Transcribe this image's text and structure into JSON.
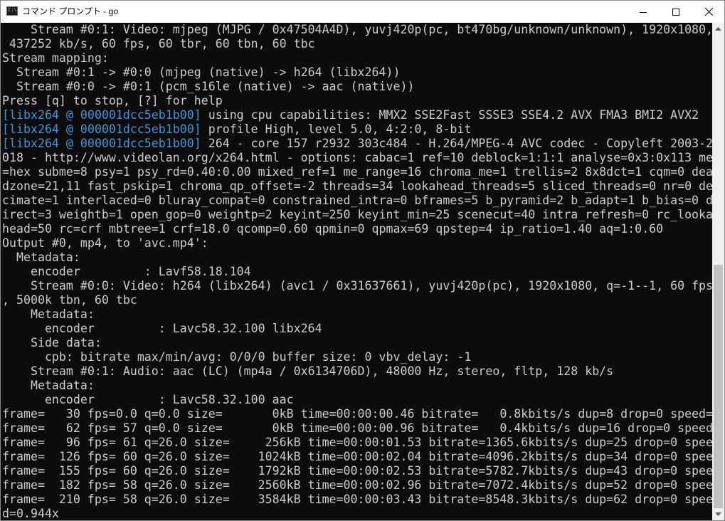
{
  "window": {
    "title": "コマンド プロンプト - go",
    "icon": "cmd-icon",
    "icon_text": "C:\\.",
    "controls": [
      "minimize-icon",
      "maximize-icon",
      "close-icon"
    ]
  },
  "colors": {
    "console_bg": "#0c0c0c",
    "console_text": "#cccccc",
    "tag_text": "#3a96dd"
  },
  "console": {
    "lines": [
      {
        "text": "    Stream #0:1: Video: mjpeg (MJPG / 0x47504A4D), yuvj420p(pc, bt470bg/unknown/unknown), 1920x1080,"
      },
      {
        "text": " 437252 kb/s, 60 fps, 60 tbr, 60 tbn, 60 tbc"
      },
      {
        "text": "Stream mapping:"
      },
      {
        "text": "  Stream #0:1 -> #0:0 (mjpeg (native) -> h264 (libx264))"
      },
      {
        "text": "  Stream #0:0 -> #0:1 (pcm_s16le (native) -> aac (native))"
      },
      {
        "text": "Press [q] to stop, [?] for help"
      },
      {
        "tag": "[libx264 @ 000001dcc5eb1b00]",
        "text": " using cpu capabilities: MMX2 SSE2Fast SSSE3 SSE4.2 AVX FMA3 BMI2 AVX2"
      },
      {
        "tag": "[libx264 @ 000001dcc5eb1b00]",
        "text": " profile High, level 5.0, 4:2:0, 8-bit"
      },
      {
        "tag": "[libx264 @ 000001dcc5eb1b00]",
        "text": " 264 - core 157 r2932 303c484 - H.264/MPEG-4 AVC codec - Copyleft 2003-2"
      },
      {
        "text": "018 - http://www.videolan.org/x264.html - options: cabac=1 ref=10 deblock=1:1:1 analyse=0x3:0x113 me"
      },
      {
        "text": "=hex subme=8 psy=1 psy_rd=0.40:0.00 mixed_ref=1 me_range=16 chroma_me=1 trellis=2 8x8dct=1 cqm=0 dea"
      },
      {
        "text": "dzone=21,11 fast_pskip=1 chroma_qp_offset=-2 threads=34 lookahead_threads=5 sliced_threads=0 nr=0 de"
      },
      {
        "text": "cimate=1 interlaced=0 bluray_compat=0 constrained_intra=0 bframes=5 b_pyramid=2 b_adapt=1 b_bias=0 d"
      },
      {
        "text": "irect=3 weightb=1 open_gop=0 weightp=2 keyint=250 keyint_min=25 scenecut=40 intra_refresh=0 rc_looka"
      },
      {
        "text": "head=50 rc=crf mbtree=1 crf=18.0 qcomp=0.60 qpmin=0 qpmax=69 qpstep=4 ip_ratio=1.40 aq=1:0.60"
      },
      {
        "text": "Output #0, mp4, to 'avc.mp4':"
      },
      {
        "text": "  Metadata:"
      },
      {
        "text": "    encoder         : Lavf58.18.104"
      },
      {
        "text": "    Stream #0:0: Video: h264 (libx264) (avc1 / 0x31637661), yuvj420p(pc), 1920x1080, q=-1--1, 60 fps"
      },
      {
        "text": ", 5000k tbn, 60 tbc"
      },
      {
        "text": "    Metadata:"
      },
      {
        "text": "      encoder         : Lavc58.32.100 libx264"
      },
      {
        "text": "    Side data:"
      },
      {
        "text": "      cpb: bitrate max/min/avg: 0/0/0 buffer size: 0 vbv_delay: -1"
      },
      {
        "text": "    Stream #0:1: Audio: aac (LC) (mp4a / 0x6134706D), 48000 Hz, stereo, fltp, 128 kb/s"
      },
      {
        "text": "    Metadata:"
      },
      {
        "text": "      encoder         : Lavc58.32.100 aac"
      },
      {
        "text": "frame=   30 fps=0.0 q=0.0 size=       0kB time=00:00:00.46 bitrate=   0.8kbits/s dup=8 drop=0 speed="
      },
      {
        "text": "frame=   62 fps= 57 q=0.0 size=       0kB time=00:00:00.96 bitrate=   0.4kbits/s dup=16 drop=0 speed"
      },
      {
        "text": "frame=   96 fps= 61 q=26.0 size=     256kB time=00:00:01.53 bitrate=1365.6kbits/s dup=25 drop=0 spee"
      },
      {
        "text": "frame=  126 fps= 60 q=26.0 size=    1024kB time=00:00:02.04 bitrate=4096.2kbits/s dup=34 drop=0 spee"
      },
      {
        "text": "frame=  155 fps= 60 q=26.0 size=    1792kB time=00:00:02.53 bitrate=5782.7kbits/s dup=43 drop=0 spee"
      },
      {
        "text": "frame=  182 fps= 58 q=26.0 size=    2560kB time=00:00:02.96 bitrate=7072.4kbits/s dup=52 drop=0 spee"
      },
      {
        "text": "frame=  210 fps= 58 q=26.0 size=    3584kB time=00:00:03.43 bitrate=8548.3kbits/s dup=62 drop=0 spee"
      },
      {
        "text": "d=0.944x"
      }
    ]
  }
}
